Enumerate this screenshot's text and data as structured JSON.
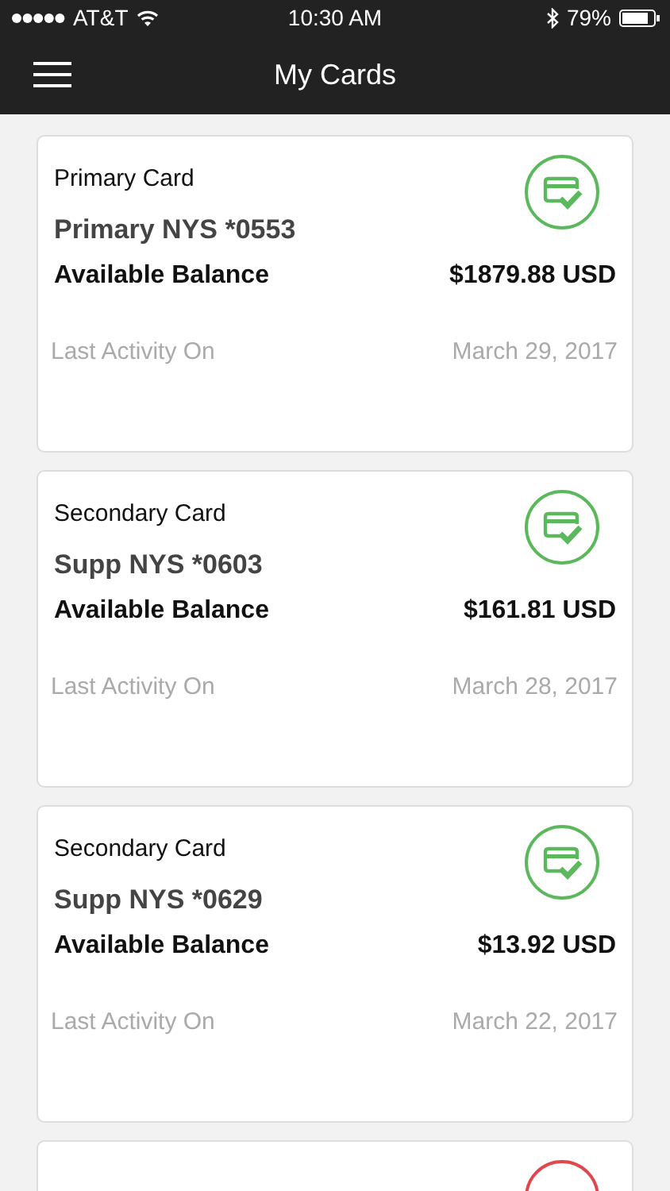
{
  "status_bar": {
    "carrier": "AT&T",
    "time": "10:30 AM",
    "battery": "79%"
  },
  "nav": {
    "title": "My Cards"
  },
  "cards": [
    {
      "type": "Primary Card",
      "name": "Primary NYS *0553",
      "balance_label": "Available Balance",
      "balance": "$1879.88 USD",
      "activity_label": "Last Activity On",
      "activity_date": "March 29, 2017",
      "active": true
    },
    {
      "type": "Secondary Card",
      "name": "Supp NYS *0603",
      "balance_label": "Available Balance",
      "balance": "$161.81 USD",
      "activity_label": "Last Activity On",
      "activity_date": "March 28, 2017",
      "active": true
    },
    {
      "type": "Secondary Card",
      "name": "Supp NYS *0629",
      "balance_label": "Available Balance",
      "balance": "$13.92 USD",
      "activity_label": "Last Activity On",
      "activity_date": "March 22, 2017",
      "active": true
    },
    {
      "active": false
    }
  ]
}
